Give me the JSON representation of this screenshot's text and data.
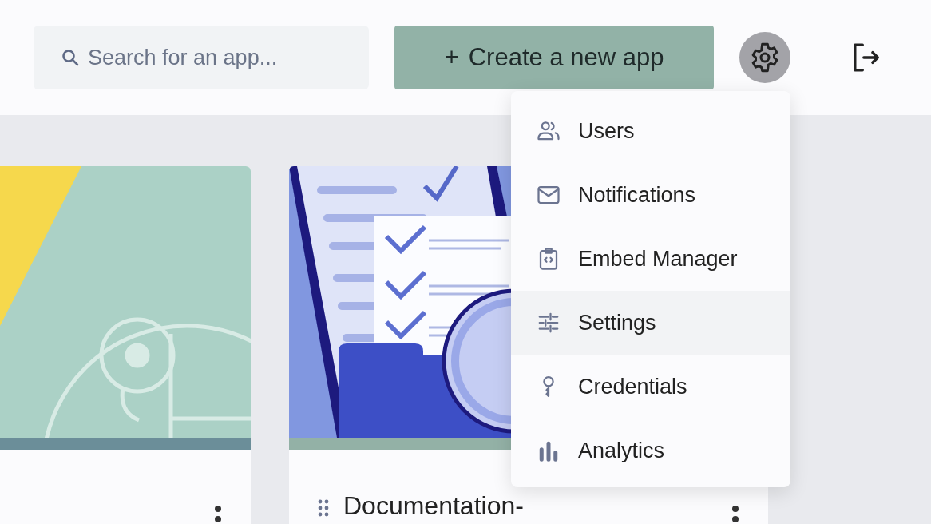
{
  "search": {
    "placeholder": "Search for an app..."
  },
  "create_button": {
    "icon": "+",
    "label": "Create a new app"
  },
  "settings_menu": {
    "open": true,
    "items": [
      {
        "label": "Users",
        "kind": "users",
        "highlighted": false
      },
      {
        "label": "Notifications",
        "kind": "mail",
        "highlighted": false
      },
      {
        "label": "Embed Manager",
        "kind": "embed",
        "highlighted": false
      },
      {
        "label": "Settings",
        "kind": "sliders",
        "highlighted": true
      },
      {
        "label": "Credentials",
        "kind": "key",
        "highlighted": false
      },
      {
        "label": "Analytics",
        "kind": "chart",
        "highlighted": false
      }
    ]
  },
  "apps": [
    {
      "kind": "camera",
      "color": "#6b8e99"
    },
    {
      "kind": "checklist",
      "title": "Documentation-",
      "color": "#93b1a6"
    }
  ]
}
